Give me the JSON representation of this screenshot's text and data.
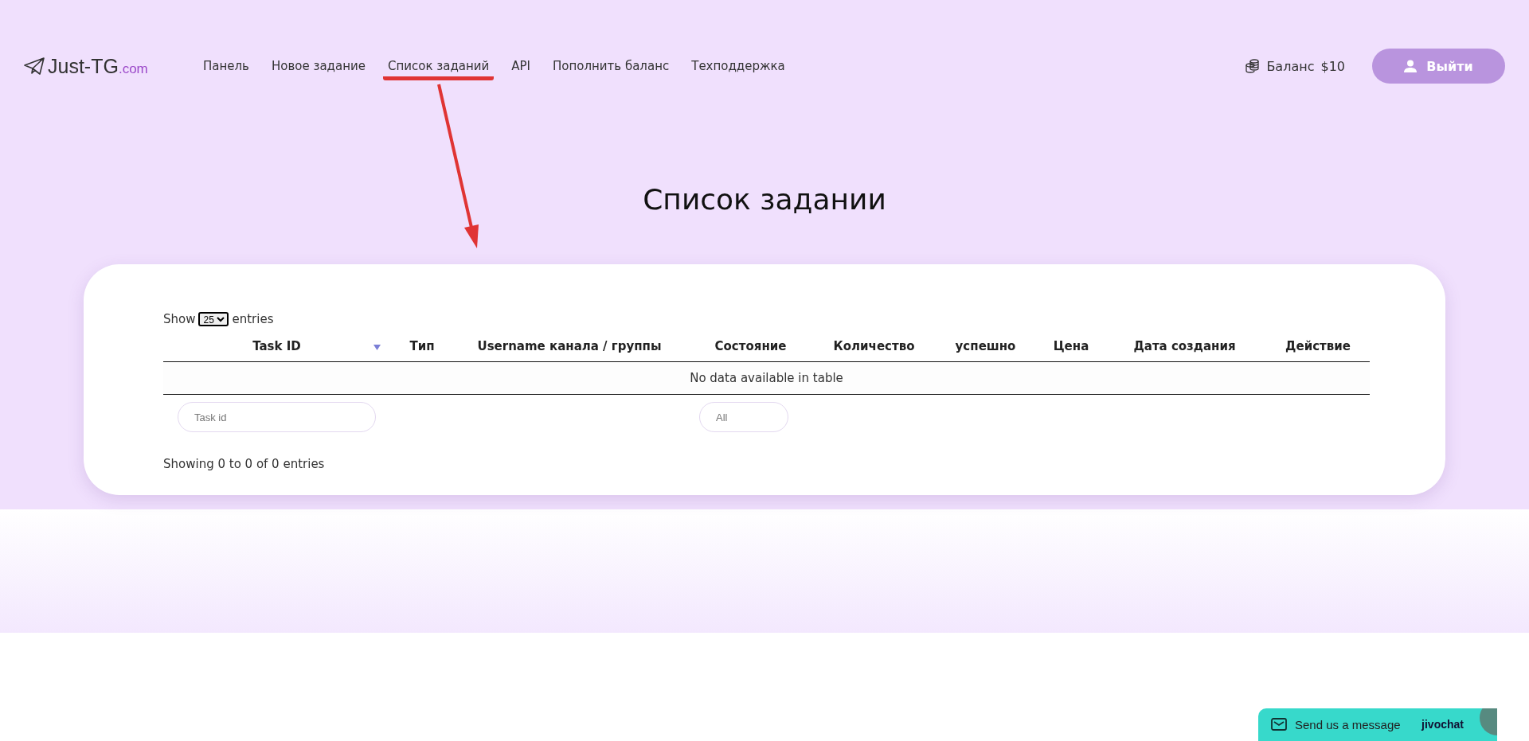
{
  "logo": {
    "name": "Just-TG",
    "suffix": ".com"
  },
  "nav": [
    {
      "label": "Панель",
      "highlighted": false
    },
    {
      "label": "Новое задание",
      "highlighted": false
    },
    {
      "label": "Список заданий",
      "highlighted": true
    },
    {
      "label": "API",
      "highlighted": false
    },
    {
      "label": "Пополнить баланс",
      "highlighted": false
    },
    {
      "label": "Техподдержка",
      "highlighted": false
    }
  ],
  "balance": {
    "label": "Баланс",
    "amount": "$10"
  },
  "logout": {
    "label": "Выйти"
  },
  "page_title": "Список задании",
  "table": {
    "length_control": {
      "before": "Show",
      "value": "25",
      "after": "entries"
    },
    "columns": [
      {
        "label": "Task ID",
        "sortable": true
      },
      {
        "label": "Тип",
        "sortable": false
      },
      {
        "label": "Username канала / группы",
        "sortable": false
      },
      {
        "label": "Состояние",
        "sortable": false
      },
      {
        "label": "Количество",
        "sortable": false
      },
      {
        "label": "успешно",
        "sortable": false
      },
      {
        "label": "Цена",
        "sortable": false
      },
      {
        "label": "Дата создания",
        "sortable": false
      },
      {
        "label": "Действие",
        "sortable": false
      }
    ],
    "empty_message": "No data available in table",
    "filters": [
      {
        "kind": "text",
        "placeholder": "Task id"
      },
      {
        "kind": "none"
      },
      {
        "kind": "none"
      },
      {
        "kind": "choice",
        "placeholder": "All"
      },
      {
        "kind": "none"
      },
      {
        "kind": "none"
      },
      {
        "kind": "none"
      },
      {
        "kind": "none"
      },
      {
        "kind": "none"
      }
    ],
    "info": "Showing 0 to 0 of 0 entries"
  },
  "chat": {
    "label": "Send us a message",
    "brand": "jivochat"
  }
}
